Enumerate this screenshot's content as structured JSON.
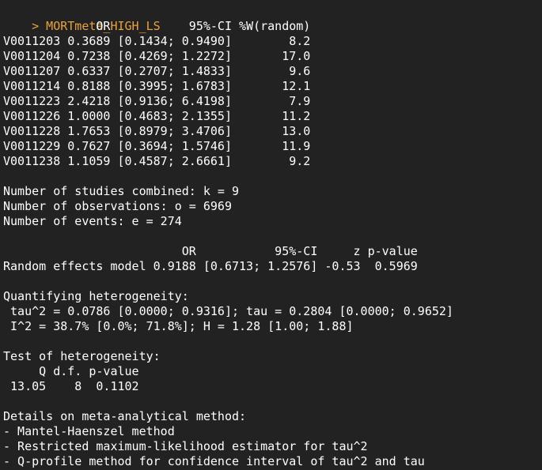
{
  "console": {
    "prev_line": "{{",
    "prompt": "> MORTmeta_HIGH_LS",
    "lines": [
      "             OR           95%-CI %W(random)",
      "V0011203 0.3689 [0.1434; 0.9490]        8.2",
      "V0011204 0.7238 [0.4269; 1.2272]       17.0",
      "V0011207 0.6337 [0.2707; 1.4833]        9.6",
      "V0011214 0.8188 [0.3995; 1.6783]       12.1",
      "V0011223 2.4218 [0.9136; 6.4198]        7.9",
      "V0011226 1.0000 [0.4683; 2.1355]       11.2",
      "V0011228 1.7653 [0.8979; 3.4706]       13.0",
      "V0011229 0.7627 [0.3694; 1.5746]       11.9",
      "V0011238 1.1059 [0.4587; 2.6661]        9.2",
      "",
      "Number of studies combined: k = 9",
      "Number of observations: o = 6969",
      "Number of events: e = 274",
      "",
      "                         OR           95%-CI     z p-value",
      "Random effects model 0.9188 [0.6713; 1.2576] -0.53  0.5969",
      "",
      "Quantifying heterogeneity:",
      " tau^2 = 0.0786 [0.0000; 0.9316]; tau = 0.2804 [0.0000; 0.9652]",
      " I^2 = 38.7% [0.0%; 71.8%]; H = 1.28 [1.00; 1.88]",
      "",
      "Test of heterogeneity:",
      "     Q d.f. p-value",
      " 13.05    8  0.1102",
      "",
      "Details on meta-analytical method:",
      "- Mantel-Haenszel method",
      "- Restricted maximum-likelihood estimator for tau^2",
      "- Q-profile method for confidence interval of tau^2 and tau"
    ]
  },
  "colors": {
    "background": "#222222",
    "text": "#ffffff",
    "command": "#e9a23b"
  }
}
